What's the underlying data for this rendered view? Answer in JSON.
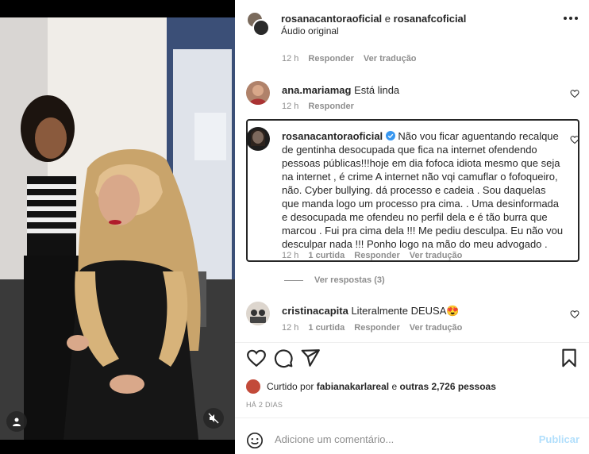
{
  "header": {
    "user1": "rosanacantoraoficial",
    "conjunction": "e",
    "user2": "rosanafcoficial",
    "subtitle": "Áudio original"
  },
  "caption_meta": {
    "time": "12 h",
    "reply": "Responder",
    "translate": "Ver tradução"
  },
  "comments": [
    {
      "user": "ana.mariamag",
      "text": "Está linda",
      "time": "12 h",
      "reply": "Responder"
    },
    {
      "user": "rosanacantoraoficial",
      "verified": true,
      "text": "Não vou ficar aguentando recalque de gentinha desocupada que fica na internet ofendendo pessoas públicas!!!hoje em dia fofoca idiota mesmo que seja na internet , é crime A internet não vqi camuflar o fofoqueiro, não. Cyber bullying. dá processo e cadeia . Sou daquelas que manda logo um processo pra cima. . Uma desinformada e desocupada me ofendeu no perfil dela e é tão burra que marcou . Fui pra cima dela !!! Me pediu desculpa. Eu não vou desculpar nada !!! Ponho logo na mão do meu advogado .",
      "time": "12 h",
      "likes": "1 curtida",
      "reply": "Responder",
      "translate": "Ver tradução",
      "view_replies": "Ver respostas (3)"
    },
    {
      "user": "cristinacapita",
      "text": "Literalmente DEUSA😍",
      "time": "12 h",
      "likes": "1 curtida",
      "reply": "Responder",
      "translate": "Ver tradução"
    }
  ],
  "likes_line": {
    "prefix": "Curtido por",
    "user": "fabianakarlareal",
    "middle": "e",
    "others": "outras 2,726 pessoas"
  },
  "date": "HÁ 2 DIAS",
  "add_comment": {
    "placeholder": "Adicione um comentário...",
    "publish": "Publicar"
  },
  "colors": {
    "text": "#262626",
    "muted": "#8e8e8e",
    "publish_disabled": "#b2dffc",
    "verified": "#3897f0"
  },
  "icons": [
    "heart-icon",
    "comment-icon",
    "share-icon",
    "bookmark-icon",
    "emoji-icon",
    "more-icon",
    "user-tag-icon",
    "mute-icon",
    "verified-icon"
  ]
}
